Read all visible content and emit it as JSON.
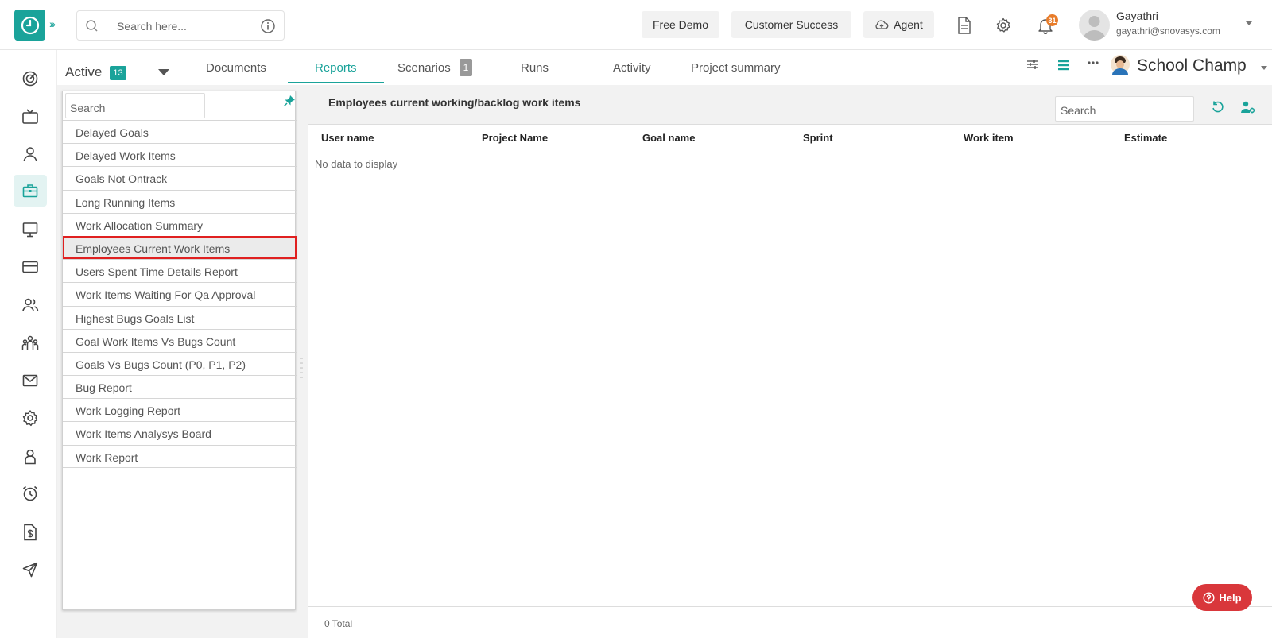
{
  "colors": {
    "accent": "#1aa39a",
    "help": "#d9373b",
    "highlight": "#e02020",
    "notification_badge": "#e87c2a"
  },
  "header": {
    "search_placeholder": "Search here...",
    "buttons": {
      "free_demo": "Free Demo",
      "customer_success": "Customer Success",
      "agent": "Agent"
    },
    "notification_count": "31",
    "user": {
      "name": "Gayathri",
      "email": "gayathri@snovasys.com"
    }
  },
  "left_nav": {
    "icons": [
      "dashboard-icon",
      "tv-icon",
      "user-icon",
      "briefcase-icon",
      "monitor-icon",
      "card-icon",
      "users-icon",
      "team-icon",
      "mail-icon",
      "settings-icon",
      "person-badge-icon",
      "alarm-icon",
      "invoice-icon",
      "send-icon"
    ],
    "active_index": 3
  },
  "tabs_row": {
    "active_label": "Active",
    "active_count": "13",
    "tabs": [
      {
        "label": "Documents"
      },
      {
        "label": "Reports"
      },
      {
        "label": "Scenarios",
        "count": "1"
      },
      {
        "label": "Runs"
      },
      {
        "label": "Activity"
      },
      {
        "label": "Project summary"
      }
    ],
    "selected_tab": "Reports",
    "project_name": "School Champ"
  },
  "reports_panel": {
    "search_placeholder": "Search",
    "items": [
      "Delayed Goals",
      "Delayed Work Items",
      "Goals Not Ontrack",
      "Long Running Items",
      "Work Allocation Summary",
      "Employees Current Work Items",
      "Users Spent Time Details Report",
      "Work Items Waiting For Qa Approval",
      "Highest Bugs Goals List",
      "Goal Work Items Vs Bugs Count",
      "Goals Vs Bugs Count (P0, P1, P2)",
      "Bug Report",
      "Work Logging Report",
      "Work Items Analysys Board",
      "Work Report"
    ],
    "selected_item": "Employees Current Work Items"
  },
  "report": {
    "title": "Employees current working/backlog work items",
    "search_placeholder": "Search",
    "columns": [
      "User name",
      "Project Name",
      "Goal name",
      "Sprint",
      "Work item",
      "Estimate"
    ],
    "empty_message": "No data to display",
    "footer_total": "0 Total"
  },
  "help_label": "Help"
}
